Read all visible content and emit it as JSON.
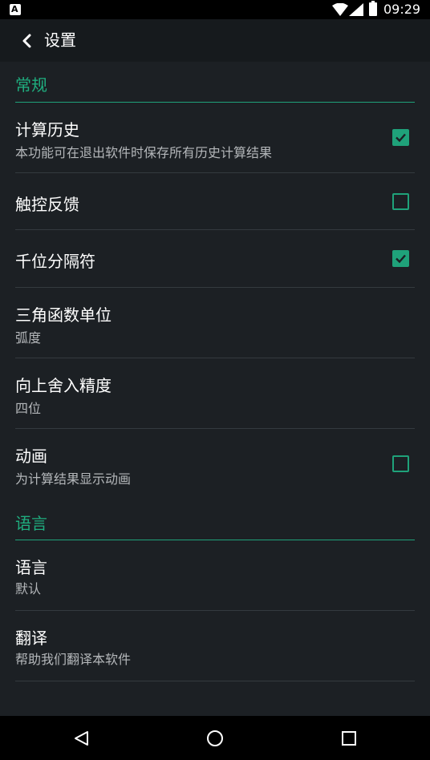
{
  "status_bar": {
    "time": "09:29",
    "notification_glyph": "A"
  },
  "toolbar": {
    "title": "设置",
    "back_icon": "chevron-left-icon"
  },
  "categories": {
    "general": "常规",
    "language": "语言"
  },
  "prefs": {
    "history": {
      "title": "计算历史",
      "summary": "本功能可在退出软件时保存所有历史计算结果",
      "checked": true
    },
    "haptic": {
      "title": "触控反馈",
      "checked": false
    },
    "thousands": {
      "title": "千位分隔符",
      "checked": true
    },
    "trig": {
      "title": "三角函数单位",
      "summary": "弧度"
    },
    "rounding": {
      "title": "向上舍入精度",
      "summary": "四位"
    },
    "animation": {
      "title": "动画",
      "summary": "为计算结果显示动画",
      "checked": false
    },
    "language": {
      "title": "语言",
      "summary": "默认"
    },
    "translate": {
      "title": "翻译",
      "summary": "帮助我们翻译本软件"
    }
  },
  "nav": {
    "back": "back-triangle-icon",
    "home": "home-circle-icon",
    "recents": "recents-square-icon"
  },
  "colors": {
    "accent": "#1fa27a",
    "background": "#1c2024",
    "toolbar": "#161a1d"
  }
}
